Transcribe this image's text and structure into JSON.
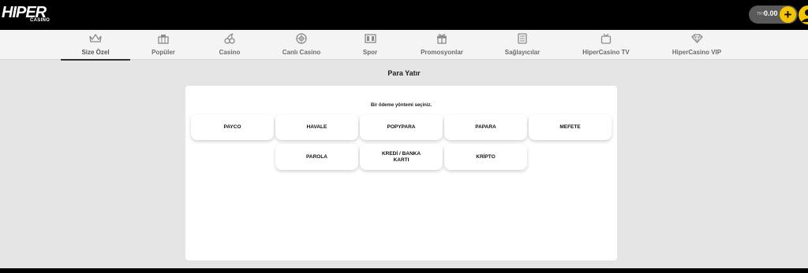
{
  "brand": {
    "name": "HIPER",
    "sub": "CASINO"
  },
  "account": {
    "currency": "TRY",
    "balance": "0.00",
    "deposit_symbol": "+"
  },
  "nav": {
    "items": [
      {
        "label": "Size Özel",
        "icon": "crown-icon",
        "active": true
      },
      {
        "label": "Popüler",
        "icon": "slot-machine-icon"
      },
      {
        "label": "Casino",
        "icon": "cherries-icon"
      },
      {
        "label": "Canlı Casino",
        "icon": "roulette-wheel-icon"
      },
      {
        "label": "Spor",
        "icon": "scoreboard-icon"
      },
      {
        "label": "Promosyonlar",
        "icon": "gift-icon"
      },
      {
        "label": "Sağlayıcılar",
        "icon": "provider-machine-icon"
      },
      {
        "label": "HiperCasino TV",
        "icon": "tv-icon"
      },
      {
        "label": "HiperCasino VIP",
        "icon": "diamond-icon"
      }
    ]
  },
  "page": {
    "title": "Para Yatır",
    "caption": "Bir ödeme yöntemi seçiniz."
  },
  "payment_methods": [
    "PAYCO",
    "HAVALE",
    "POPYPARA",
    "PAPARA",
    "MEFETE",
    "PAROLA",
    "KREDİ / BANKA KARTI",
    "KRİPTO"
  ]
}
